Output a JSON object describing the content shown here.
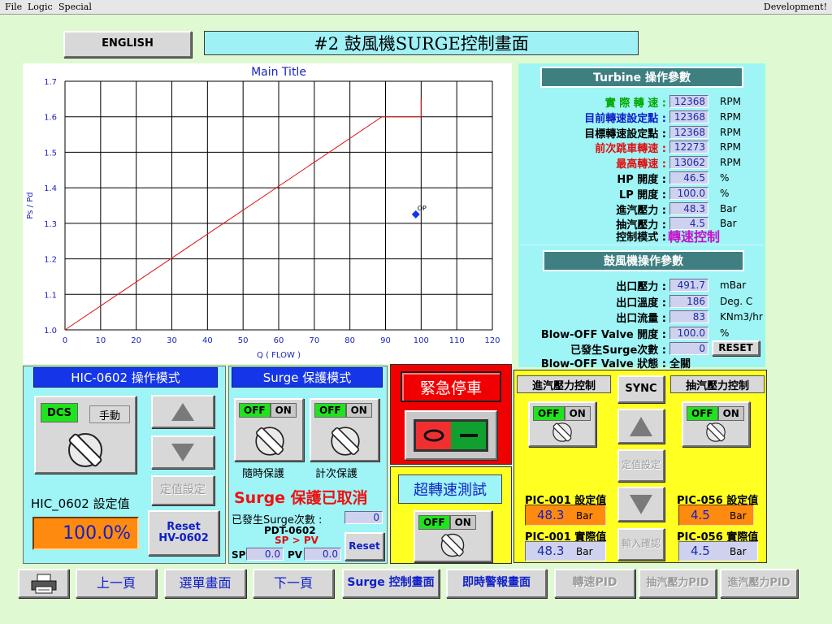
{
  "menu": {
    "file": "File",
    "logic": "Logic",
    "special": "Special",
    "development": "Development!"
  },
  "english_button": "ENGLISH",
  "page_title": "#2  鼓風機SURGE控制畫面",
  "chart_data": {
    "type": "line",
    "title": "Main Title",
    "xlabel": "Q ( FLOW )",
    "ylabel": "Ps / Pd",
    "xlim": [
      0,
      120
    ],
    "ylim": [
      1.0,
      1.7
    ],
    "xticks": [
      "0",
      "10",
      "20",
      "30",
      "40",
      "50",
      "60",
      "70",
      "80",
      "90",
      "100",
      "110",
      "120"
    ],
    "yticks": [
      "1.0",
      "1.1",
      "1.2",
      "1.3",
      "1.4",
      "1.5",
      "1.6",
      "1.7"
    ],
    "grid": true,
    "surge_line": [
      [
        0,
        1.0
      ],
      [
        89,
        1.6
      ],
      [
        100,
        1.6
      ],
      [
        100,
        1.65
      ]
    ],
    "operating_point": {
      "label": "OP",
      "x": 98.5,
      "y": 1.325
    },
    "colors": {
      "line": "#e01010",
      "point": "#1536e8",
      "text": "#1a24c0"
    }
  },
  "turbine": {
    "header": "Turbine 操作參數",
    "rows": [
      {
        "label": "實 際 轉 速 :",
        "value": "12368",
        "unit": "RPM",
        "color": "#00aa00"
      },
      {
        "label": "目前轉速設定點 :",
        "value": "12368",
        "unit": "RPM",
        "color": "#1020c8"
      },
      {
        "label": "目標轉速設定點 :",
        "value": "12368",
        "unit": "RPM",
        "color": "#000000"
      },
      {
        "label": "前次跳車轉速 :",
        "value": "12273",
        "unit": "RPM",
        "color": "#e01010"
      },
      {
        "label": "最高轉速 :",
        "value": "13062",
        "unit": "RPM",
        "color": "#e01010"
      },
      {
        "label": "HP 開度 :",
        "value": "46.5",
        "unit": "%",
        "color": "#000000"
      },
      {
        "label": "LP 開度 :",
        "value": "100.0",
        "unit": "%",
        "color": "#000000"
      },
      {
        "label": "進汽壓力 :",
        "value": "48.3",
        "unit": "Bar",
        "color": "#000000"
      },
      {
        "label": "抽汽壓力 :",
        "value": "4.5",
        "unit": "Bar",
        "color": "#000000"
      }
    ],
    "mode_label": "控制模式 :",
    "mode_value": "轉速控制"
  },
  "blower": {
    "header": "鼓風機操作參數",
    "rows": [
      {
        "label": "出口壓力 :",
        "value": "491.7",
        "unit": "mBar"
      },
      {
        "label": "出口溫度 :",
        "value": "186",
        "unit": "Deg. C"
      },
      {
        "label": "出口流量 :",
        "value": "83",
        "unit": "KNm3/hr"
      },
      {
        "label": "Blow-OFF Valve 開度 :",
        "value": "100.0",
        "unit": "%"
      },
      {
        "label": "已發生Surge次數 :",
        "value": "0",
        "unit": ""
      }
    ],
    "reset": "RESET",
    "status_label": "Blow-OFF Valve 狀態 :",
    "status_value": "全關"
  },
  "hic": {
    "header": "HIC-0602 操作模式",
    "dcs": "DCS",
    "manual": "手動",
    "setpoint_btn": "定值設定",
    "setpoint_label": "HIC_0602 設定值",
    "setpoint_value": "100.0%",
    "reset_btn": "Reset HV-0602"
  },
  "surge": {
    "header": "Surge 保護模式",
    "sw1_off": "OFF",
    "sw1_on": "ON",
    "sw1_label": "隨時保護",
    "sw2_off": "OFF",
    "sw2_on": "ON",
    "sw2_label": "計次保護",
    "status": "Surge 保護已取消",
    "count_label": "已發生Surge次數 :",
    "count_value": "0",
    "pdt_label": "PDT-0602",
    "condition": "SP > PV",
    "sp_label": "SP",
    "sp_value": "0.0",
    "pv_label": "PV",
    "pv_value": "0.0",
    "reset": "Reset"
  },
  "emergency": {
    "label": "緊急停車"
  },
  "overspeed": {
    "label": "超轉速測試",
    "off": "OFF",
    "on": "ON"
  },
  "pressure": {
    "inlet_header": "進汽壓力控制",
    "extract_header": "抽汽壓力控制",
    "sync": "SYNC",
    "sw_off": "OFF",
    "sw_on": "ON",
    "setpoint_btn": "定值設定",
    "confirm_btn": "輸入確認",
    "pic001_sp_label": "PIC-001 設定值",
    "pic001_sp_value": "48.3",
    "pic001_sp_unit": "Bar",
    "pic001_pv_label": "PIC-001 實際值",
    "pic001_pv_value": "48.3",
    "pic001_pv_unit": "Bar",
    "pic056_sp_label": "PIC-056 設定值",
    "pic056_sp_value": "4.5",
    "pic056_sp_unit": "Bar",
    "pic056_pv_label": "PIC-056 實際值",
    "pic056_pv_value": "4.5",
    "pic056_pv_unit": "Bar"
  },
  "bottom_nav": {
    "prev": "上一頁",
    "menu": "選單畫面",
    "next": "下一頁",
    "surge": "Surge 控制畫面",
    "alarm": "即時警報畫面",
    "speed_pid": "轉速PID",
    "extract_pid": "抽汽壓力PID",
    "inlet_pid": "進汽壓力PID"
  }
}
